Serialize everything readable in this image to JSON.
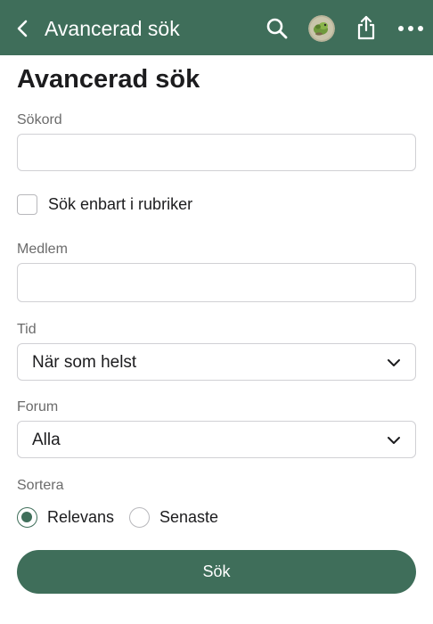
{
  "header": {
    "title": "Avancerad sök"
  },
  "page": {
    "heading": "Avancerad sök"
  },
  "form": {
    "keywords": {
      "label": "Sökord",
      "value": ""
    },
    "titles_only": {
      "label": "Sök enbart i rubriker",
      "checked": false
    },
    "member": {
      "label": "Medlem",
      "value": ""
    },
    "time": {
      "label": "Tid",
      "selected": "När som helst"
    },
    "forum": {
      "label": "Forum",
      "selected": "Alla"
    },
    "sort": {
      "label": "Sortera",
      "options": [
        {
          "label": "Relevans",
          "checked": true
        },
        {
          "label": "Senaste",
          "checked": false
        }
      ]
    },
    "submit_label": "Sök"
  },
  "colors": {
    "accent": "#3f6e5a",
    "border": "#d0d0d4",
    "label": "#6b6b6b"
  },
  "icons": [
    "back-chevron-icon",
    "search-icon",
    "avatar",
    "share-icon",
    "more-icon",
    "chevron-down-icon"
  ]
}
